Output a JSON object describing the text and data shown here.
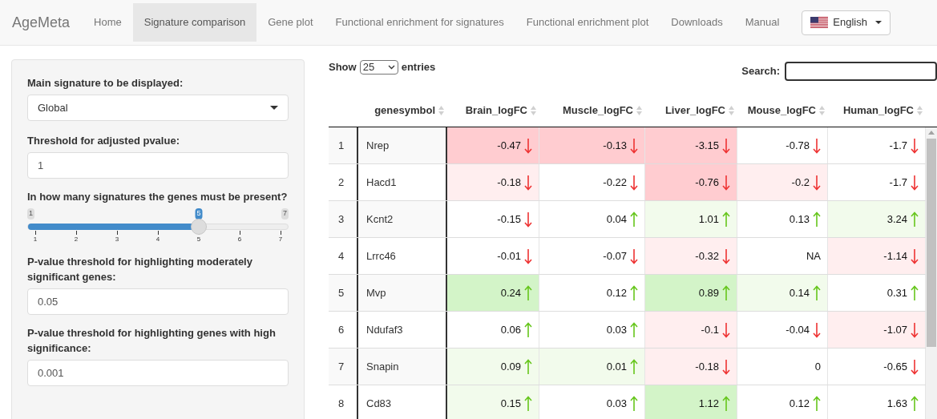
{
  "navbar": {
    "brand": "AgeMeta",
    "items": [
      {
        "label": "Home",
        "selected": false
      },
      {
        "label": "Signature comparison",
        "selected": true
      },
      {
        "label": "Gene plot",
        "selected": false
      },
      {
        "label": "Functional enrichment for signatures",
        "selected": false
      },
      {
        "label": "Functional enrichment plot",
        "selected": false
      },
      {
        "label": "Downloads",
        "selected": false
      },
      {
        "label": "Manual",
        "selected": false
      }
    ],
    "language": "English"
  },
  "sidebar": {
    "controls": [
      {
        "kind": "select",
        "label": "Main signature to be displayed:",
        "value": "Global"
      },
      {
        "kind": "input",
        "label": "Threshold for adjusted pvalue:",
        "value": "1"
      },
      {
        "kind": "slider",
        "label": "In how many signatures the genes must be present?",
        "min": "1",
        "max": "7",
        "value": "5",
        "level": 0.6667,
        "ticks": [
          "1",
          "2",
          "3",
          "4",
          "5",
          "6",
          "7"
        ]
      },
      {
        "kind": "input",
        "label": "P-value threshold for highlighting moderately significant genes:",
        "value": "0.05"
      },
      {
        "kind": "input",
        "label": "P-value threshold for highlighting genes with high significance:",
        "value": "0.001"
      }
    ]
  },
  "table": {
    "length_label_before": "Show",
    "length_value": "25",
    "length_label_after": "entries",
    "search_label": "Search:",
    "columns": [
      "",
      "genesymbol",
      "Brain_logFC",
      "Muscle_logFC",
      "Liver_logFC",
      "Mouse_logFC",
      "Human_logFC"
    ],
    "rows": [
      {
        "cells": [
          {
            "kind": "index",
            "value": "1"
          },
          {
            "kind": "gene",
            "value": "Nrep"
          },
          {
            "kind": "down",
            "value": "-0.47",
            "color": "#ffccd0"
          },
          {
            "kind": "down",
            "value": "-0.13",
            "color": "#ffccd0"
          },
          {
            "kind": "down",
            "value": "-3.15",
            "color": "#ffccd0"
          },
          {
            "kind": "down",
            "value": "-0.78",
            "color": "#ffffff"
          },
          {
            "kind": "down",
            "value": "-1.7",
            "color": "#ffffff"
          }
        ]
      },
      {
        "cells": [
          {
            "kind": "index",
            "value": "2"
          },
          {
            "kind": "gene",
            "value": "Hacd1"
          },
          {
            "kind": "down",
            "value": "-0.18",
            "color": "#ffeeef"
          },
          {
            "kind": "down",
            "value": "-0.22",
            "color": "#ffffff"
          },
          {
            "kind": "down",
            "value": "-0.76",
            "color": "#ffccd0"
          },
          {
            "kind": "down",
            "value": "-0.2",
            "color": "#ffeeef"
          },
          {
            "kind": "down",
            "value": "-1.7",
            "color": "#ffffff"
          }
        ]
      },
      {
        "cells": [
          {
            "kind": "index",
            "value": "3"
          },
          {
            "kind": "gene",
            "value": "Kcnt2"
          },
          {
            "kind": "down",
            "value": "-0.15",
            "color": "#ffffff"
          },
          {
            "kind": "up",
            "value": "0.04",
            "color": "#ffffff"
          },
          {
            "kind": "up",
            "value": "1.01",
            "color": "#f2fbec"
          },
          {
            "kind": "up",
            "value": "0.13",
            "color": "#ffffff"
          },
          {
            "kind": "up",
            "value": "3.24",
            "color": "#f2fbec"
          }
        ]
      },
      {
        "cells": [
          {
            "kind": "index",
            "value": "4"
          },
          {
            "kind": "gene",
            "value": "Lrrc46"
          },
          {
            "kind": "down",
            "value": "-0.01",
            "color": "#ffffff"
          },
          {
            "kind": "down",
            "value": "-0.07",
            "color": "#ffffff"
          },
          {
            "kind": "down",
            "value": "-0.32",
            "color": "#ffeeef"
          },
          {
            "kind": "plain",
            "value": "NA",
            "color": "#ffffff"
          },
          {
            "kind": "down",
            "value": "-1.14",
            "color": "#ffeeef"
          }
        ]
      },
      {
        "cells": [
          {
            "kind": "index",
            "value": "5"
          },
          {
            "kind": "gene",
            "value": "Mvp"
          },
          {
            "kind": "up",
            "value": "0.24",
            "color": "#d3f4c8"
          },
          {
            "kind": "up",
            "value": "0.12",
            "color": "#ffffff"
          },
          {
            "kind": "up",
            "value": "0.89",
            "color": "#d3f4c8"
          },
          {
            "kind": "up",
            "value": "0.14",
            "color": "#f2fbec"
          },
          {
            "kind": "up",
            "value": "0.31",
            "color": "#ffffff"
          }
        ]
      },
      {
        "cells": [
          {
            "kind": "index",
            "value": "6"
          },
          {
            "kind": "gene",
            "value": "Ndufaf3"
          },
          {
            "kind": "up",
            "value": "0.06",
            "color": "#ffffff"
          },
          {
            "kind": "up",
            "value": "0.03",
            "color": "#ffffff"
          },
          {
            "kind": "down",
            "value": "-0.1",
            "color": "#ffeeef"
          },
          {
            "kind": "down",
            "value": "-0.04",
            "color": "#ffffff"
          },
          {
            "kind": "down",
            "value": "-1.07",
            "color": "#ffeeef"
          }
        ]
      },
      {
        "cells": [
          {
            "kind": "index",
            "value": "7"
          },
          {
            "kind": "gene",
            "value": "Snapin"
          },
          {
            "kind": "up",
            "value": "0.09",
            "color": "#f2fbec"
          },
          {
            "kind": "up",
            "value": "0.01",
            "color": "#f2fbec"
          },
          {
            "kind": "down",
            "value": "-0.18",
            "color": "#ffeeef"
          },
          {
            "kind": "plain",
            "value": "0",
            "color": "#ffffff"
          },
          {
            "kind": "down",
            "value": "-0.65",
            "color": "#ffffff"
          }
        ]
      },
      {
        "cells": [
          {
            "kind": "index",
            "value": "8"
          },
          {
            "kind": "gene",
            "value": "Cd83"
          },
          {
            "kind": "up",
            "value": "0.15",
            "color": "#f2fbec"
          },
          {
            "kind": "up",
            "value": "0.03",
            "color": "#ffffff"
          },
          {
            "kind": "up",
            "value": "1.12",
            "color": "#d3f4c8"
          },
          {
            "kind": "up",
            "value": "0.12",
            "color": "#ffffff"
          },
          {
            "kind": "up",
            "value": "1.63",
            "color": "#ffffff"
          }
        ]
      }
    ]
  }
}
